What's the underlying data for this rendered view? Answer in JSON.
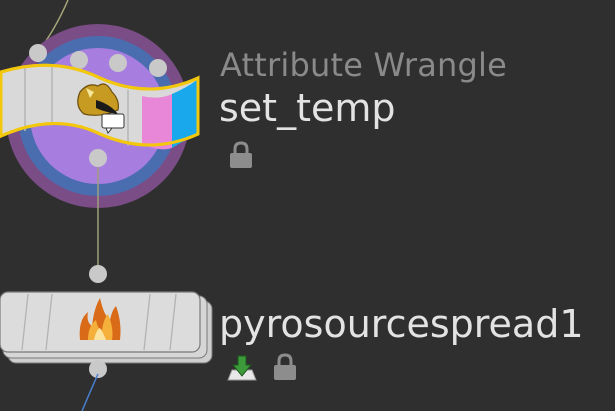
{
  "network": {
    "nodes": [
      {
        "type_label": "Attribute Wrangle",
        "name": "set_temp",
        "locked": true,
        "selected": true,
        "icon": "wizard-hat-icon"
      },
      {
        "type_label": "",
        "name": "pyrosourcespread1",
        "locked": true,
        "selected": false,
        "icon": "fire-icon",
        "cache_flag": "download-arrow-icon"
      }
    ]
  },
  "colors": {
    "background": "#2f2f2f",
    "node_body": "#d9d9d9",
    "selection_outline": "#f2c70c",
    "ring_outer": "#7a4d86",
    "ring_middle": "#4a6db0",
    "ring_inner": "#a77de0",
    "tail_pink": "#e887d8",
    "tail_blue": "#1aa8ec",
    "wire": "#9da07a"
  }
}
